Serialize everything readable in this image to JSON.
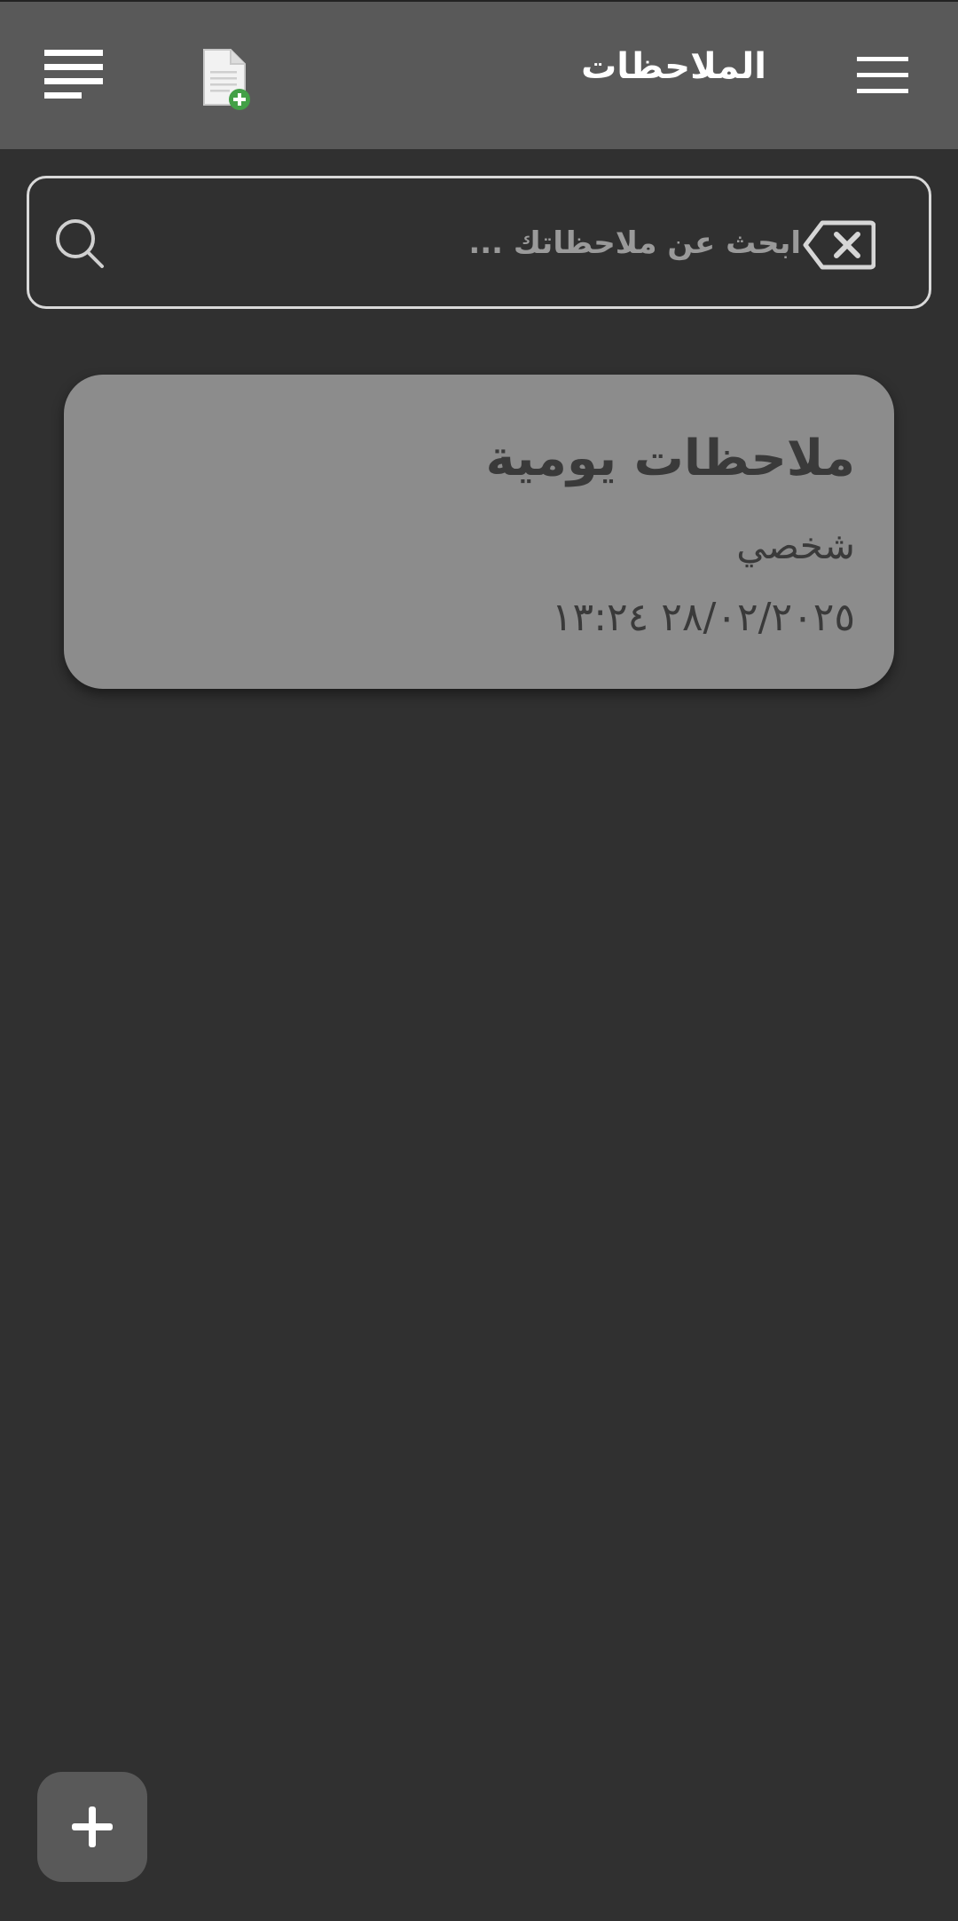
{
  "header": {
    "title": "الملاحظات",
    "left_icon": "text-align-icon",
    "new_note_icon": "new-document-icon",
    "menu_icon": "hamburger-menu-icon"
  },
  "search": {
    "placeholder": "ابحث عن ملاحظاتك ...",
    "value": "",
    "search_icon": "search-icon",
    "clear_icon": "backspace-clear-icon"
  },
  "notes": [
    {
      "title": "ملاحظات يومية",
      "category": "شخصي",
      "date": "٢٨/٠٢/٢٠٢٥ ١٣:٢٤"
    }
  ],
  "fab": {
    "icon": "plus-icon"
  },
  "colors": {
    "background": "#303030",
    "header": "#595959",
    "card": "#8c8c8c",
    "card_text": "#3a3a3a",
    "accent_green": "#43a047"
  }
}
